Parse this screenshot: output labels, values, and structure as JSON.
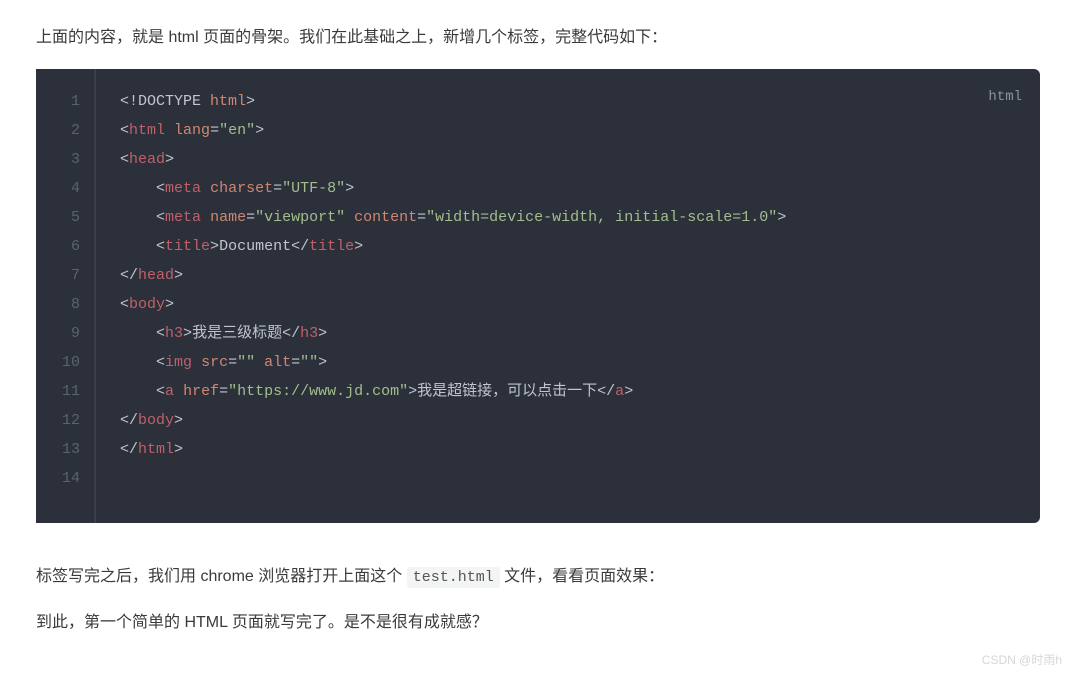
{
  "para1": "上面的内容，就是 html 页面的骨架。我们在此基础之上，新增几个标签，完整代码如下：",
  "lang_label": "html",
  "line_numbers": [
    "1",
    "2",
    "3",
    "4",
    "5",
    "6",
    "7",
    "8",
    "9",
    "10",
    "11",
    "12",
    "13",
    "14"
  ],
  "code": {
    "l1": {
      "t1": "<!",
      "t2": "DOCTYPE",
      "t3": " html",
      "t4": ">"
    },
    "l2": {
      "t1": "<",
      "t2": "html",
      "t3": " ",
      "a1": "lang",
      "t4": "=",
      "s1": "\"en\"",
      "t5": ">"
    },
    "l3": {
      "t1": "<",
      "t2": "head",
      "t3": ">"
    },
    "l4": {
      "ind": "    ",
      "t1": "<",
      "t2": "meta",
      "t3": " ",
      "a1": "charset",
      "t4": "=",
      "s1": "\"UTF-8\"",
      "t5": ">"
    },
    "l5": {
      "ind": "    ",
      "t1": "<",
      "t2": "meta",
      "t3": " ",
      "a1": "name",
      "t4": "=",
      "s1": "\"viewport\"",
      "t5": " ",
      "a2": "content",
      "t6": "=",
      "s2": "\"width=device-width, initial-scale=1.0\"",
      "t7": ">"
    },
    "l6": {
      "ind": "    ",
      "t1": "<",
      "t2": "title",
      "t3": ">",
      "tx": "Document",
      "t4": "</",
      "t5": "title",
      "t6": ">"
    },
    "l7": {
      "t1": "</",
      "t2": "head",
      "t3": ">"
    },
    "l8": {
      "t1": "<",
      "t2": "body",
      "t3": ">"
    },
    "l9": {
      "ind": "    ",
      "t1": "<",
      "t2": "h3",
      "t3": ">",
      "tx": "我是三级标题",
      "t4": "</",
      "t5": "h3",
      "t6": ">"
    },
    "l10": {
      "ind": "    ",
      "t1": "<",
      "t2": "img",
      "t3": " ",
      "a1": "src",
      "t4": "=",
      "s1": "\"\"",
      "t5": " ",
      "a2": "alt",
      "t6": "=",
      "s2": "\"\"",
      "t7": ">"
    },
    "l11": {
      "ind": "    ",
      "t1": "<",
      "t2": "a",
      "t3": " ",
      "a1": "href",
      "t4": "=",
      "s1": "\"https://www.jd.com\"",
      "t5": ">",
      "tx": "我是超链接，可以点击一下",
      "t6": "</",
      "t7": "a",
      "t8": ">"
    },
    "l12": {
      "t1": "</",
      "t2": "body",
      "t3": ">"
    },
    "l13": {
      "t1": "</",
      "t2": "html",
      "t3": ">"
    },
    "l14": {
      "blank": " "
    }
  },
  "para2_a": "标签写完之后，我们用 chrome 浏览器打开上面这个 ",
  "para2_code": "test.html",
  "para2_b": " 文件，看看页面效果：",
  "para3": "到此，第一个简单的 HTML 页面就写完了。是不是很有成就感？",
  "watermark": "CSDN @时雨h"
}
